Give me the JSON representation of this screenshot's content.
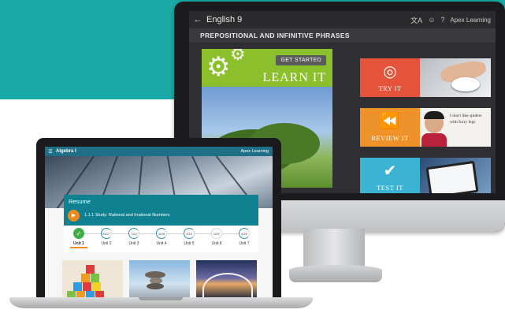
{
  "monitor": {
    "course_title": "English 9",
    "brand": "Apex Learning",
    "lesson_title": "PREPOSITIONAL AND INFINITIVE PHRASES",
    "learn": {
      "label": "LEARN IT",
      "button": "GET STARTED"
    },
    "cards": [
      {
        "label": "TRY IT",
        "icon": "target-icon"
      },
      {
        "label": "REVIEW IT",
        "icon": "rewind-icon",
        "quote": "I don't like spiders with furry legs"
      },
      {
        "label": "TEST IT",
        "icon": "checkmark-icon"
      }
    ]
  },
  "laptop": {
    "course_title": "Algebra I",
    "brand": "Apex Learning",
    "resume": {
      "title": "Resume",
      "lesson": "1.1.1 Study: Rational and Irrational Numbers"
    },
    "units": [
      {
        "label": "Unit 1",
        "progress": "",
        "state": "done"
      },
      {
        "label": "Unit 2",
        "progress": "25/27",
        "state": "progress"
      },
      {
        "label": "Unit 3",
        "progress": "7/24",
        "state": "progress"
      },
      {
        "label": "Unit 4",
        "progress": "3/28",
        "state": "progress"
      },
      {
        "label": "Unit 5",
        "progress": "4/34",
        "state": "progress"
      },
      {
        "label": "Unit 6",
        "progress": "0/20",
        "state": "todo"
      },
      {
        "label": "Unit 7",
        "progress": "4/26",
        "state": "progress"
      }
    ]
  },
  "colors": {
    "teal_band": "#1aaaa5",
    "learn_green": "#8cbf2c",
    "try_red": "#e5543a",
    "review_orange": "#f0922a",
    "test_blue": "#3db3d4",
    "laptop_header": "#1f6f86",
    "resume_teal": "#0f8190",
    "accent_orange": "#f08a1e"
  }
}
